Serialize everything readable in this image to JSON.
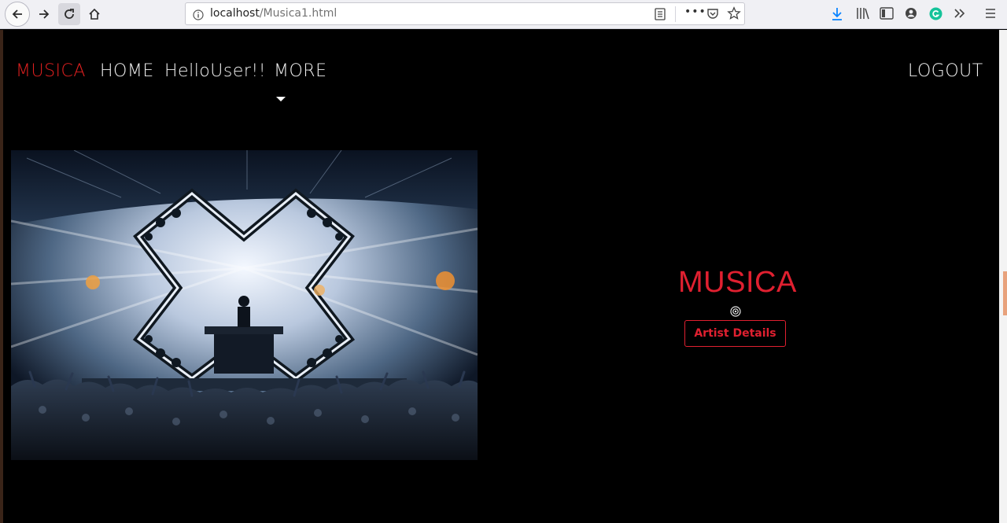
{
  "browser": {
    "url_host": "localhost",
    "url_path": "/Musica1.html",
    "url_more": "•••"
  },
  "nav": {
    "brand": "MUSICA",
    "home": "HOME",
    "user": "HelloUser!!",
    "more": "MORE",
    "logout": "LOGOUT"
  },
  "hero": {
    "brand_title": "MUSICA",
    "artist_button": "Artist Details"
  },
  "colors": {
    "accent": "#e02030",
    "background": "#000000",
    "nav_text": "#f1f1f1"
  },
  "icons": [
    "back-icon",
    "forward-icon",
    "reload-icon",
    "home-icon",
    "info-icon",
    "reader-icon",
    "pocket-icon",
    "star-icon",
    "download-icon",
    "library-icon",
    "sidebar-icon",
    "account-icon",
    "grammarly-icon",
    "overflow-icon",
    "menu-icon",
    "podcast-icon"
  ]
}
